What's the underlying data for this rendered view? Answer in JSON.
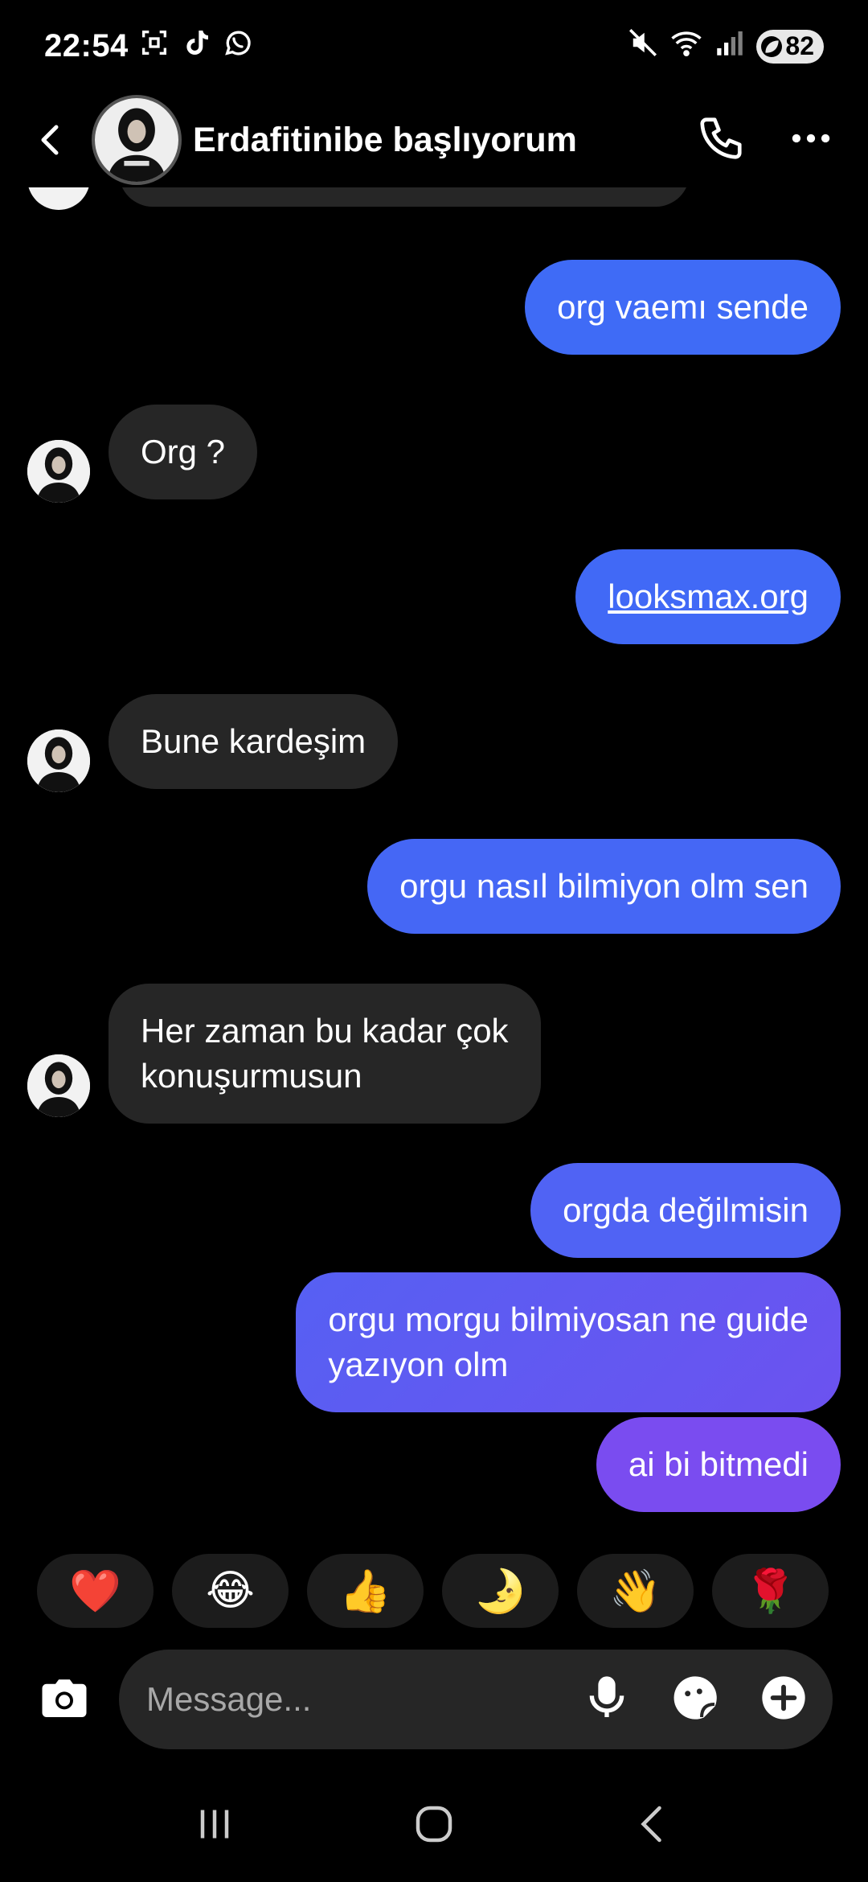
{
  "status": {
    "time": "22:54",
    "battery": "82"
  },
  "header": {
    "contact_name": "Erdafitinibe başlıyorum"
  },
  "messages": [
    {
      "side": "out",
      "text": "org vaemı sende"
    },
    {
      "side": "in",
      "text": "Org ?"
    },
    {
      "side": "out",
      "text": "looksmax.org",
      "link": true
    },
    {
      "side": "in",
      "text": "Bune kardeşim"
    },
    {
      "side": "out",
      "text": "orgu nasıl bilmiyon olm sen"
    },
    {
      "side": "in",
      "text": "Her zaman bu kadar çok\nkonuşurmusun"
    },
    {
      "side": "out",
      "text": "orgda değilmisin"
    },
    {
      "side": "out",
      "text": "orgu morgu bilmiyosan ne guide\nyazıyon olm"
    },
    {
      "side": "out",
      "text": "ai bi bitmedi"
    }
  ],
  "reactions": [
    "❤️",
    "😂",
    "👍",
    "🌛",
    "👋",
    "🌹"
  ],
  "composer": {
    "placeholder": "Message..."
  },
  "colors": {
    "outgoing_top": "#3f6bf6",
    "outgoing_bottom": "#7a4cf0",
    "incoming": "#262626"
  }
}
